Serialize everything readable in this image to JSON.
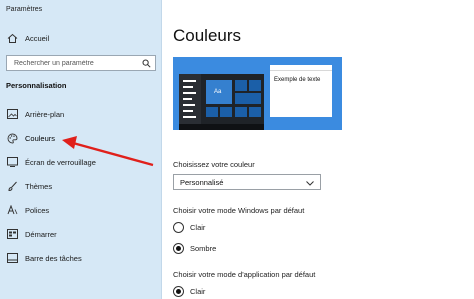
{
  "window": {
    "title": "Paramètres"
  },
  "sidebar": {
    "home_label": "Accueil",
    "search_placeholder": "Rechercher un paramètre",
    "section_title": "Personnalisation",
    "items": [
      {
        "label": "Arrière-plan",
        "icon": "image-icon"
      },
      {
        "label": "Couleurs",
        "icon": "palette-icon",
        "selected": true
      },
      {
        "label": "Écran de verrouillage",
        "icon": "lock-screen-icon"
      },
      {
        "label": "Thèmes",
        "icon": "brush-icon"
      },
      {
        "label": "Polices",
        "icon": "font-icon"
      },
      {
        "label": "Démarrer",
        "icon": "start-menu-icon"
      },
      {
        "label": "Barre des tâches",
        "icon": "taskbar-icon"
      }
    ]
  },
  "main": {
    "title": "Couleurs",
    "preview": {
      "sample_text": "Exemple de texte",
      "tile_label": "Aa",
      "accent_color": "#3b8be0"
    },
    "choose_color": {
      "label": "Choisissez votre couleur",
      "selected": "Personnalisé"
    },
    "windows_mode": {
      "label": "Choisir votre mode Windows par défaut",
      "options": [
        {
          "label": "Clair",
          "checked": false
        },
        {
          "label": "Sombre",
          "checked": true
        }
      ]
    },
    "app_mode": {
      "label": "Choisir votre mode d'application par défaut",
      "options": [
        {
          "label": "Clair",
          "checked": true
        }
      ]
    }
  },
  "annotation": {
    "arrow_color": "#e0201b"
  }
}
